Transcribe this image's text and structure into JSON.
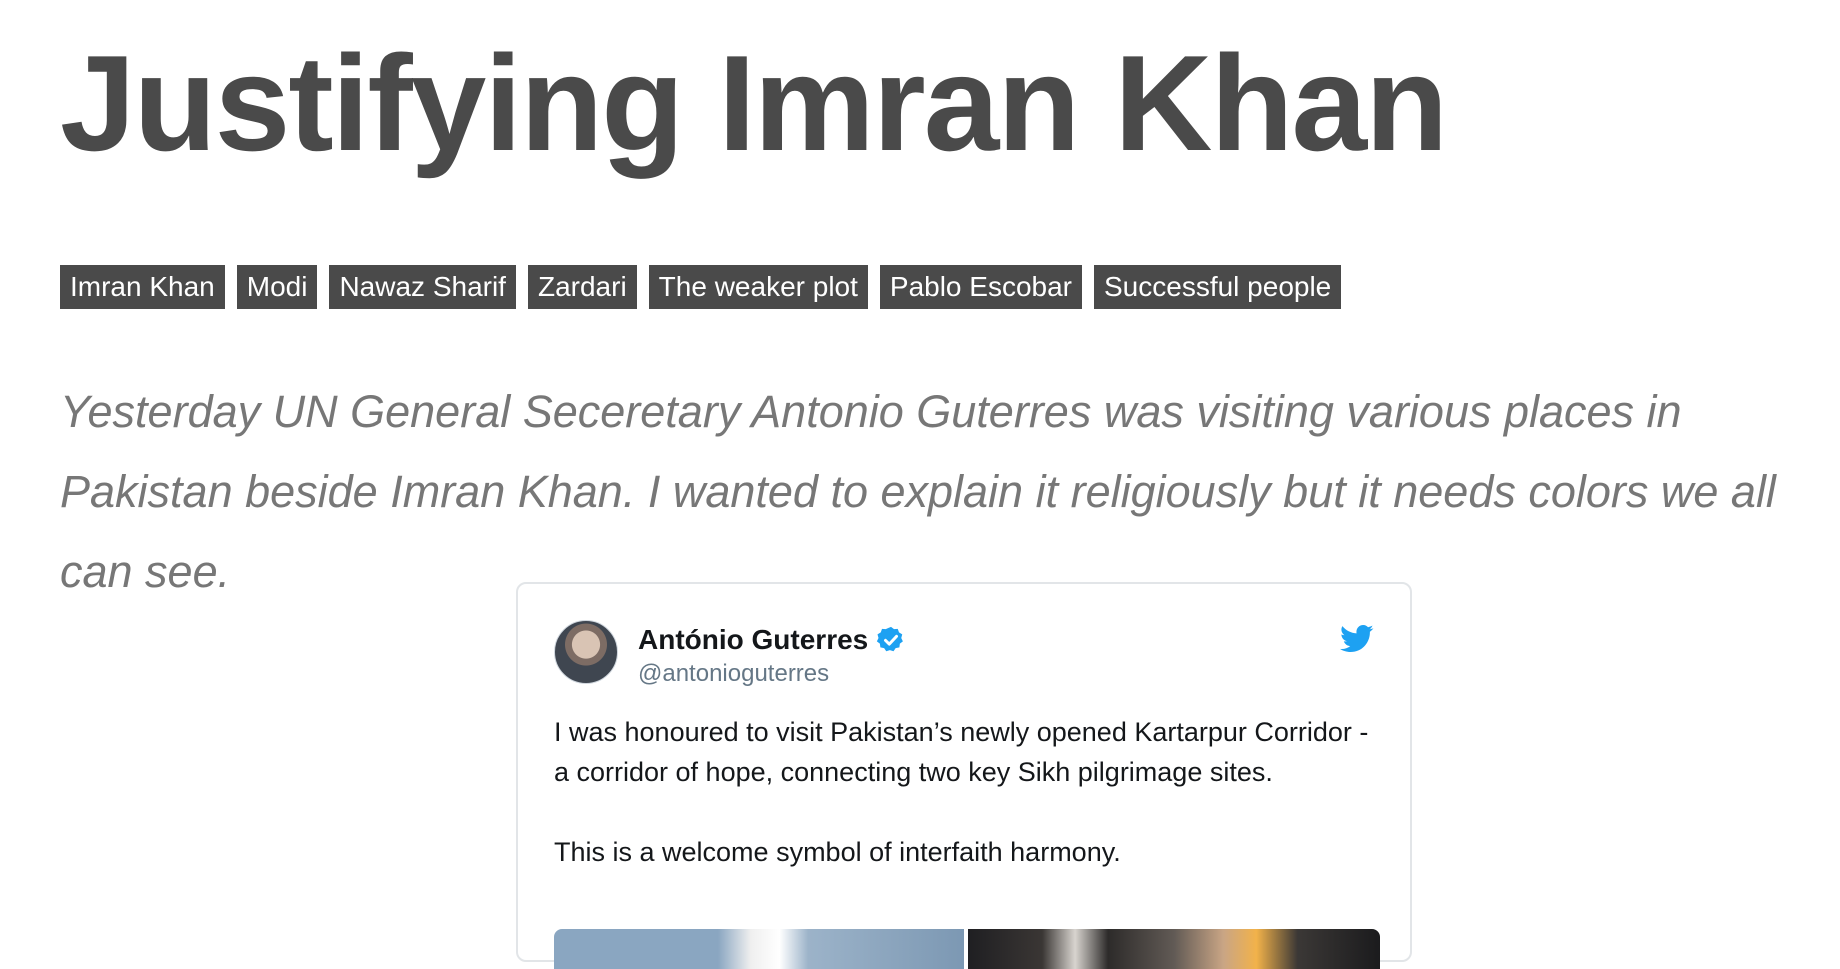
{
  "article": {
    "title": "Justifying Imran Khan",
    "tags": [
      "Imran Khan",
      "Modi",
      "Nawaz Sharif",
      "Zardari",
      "The weaker plot",
      "Pablo Escobar",
      "Successful people"
    ],
    "lead": "Yesterday UN General Seceretary Antonio Guterres was visiting various places in Pakistan beside Imran Khan. I wanted to explain it religiously but it needs colors we all can see."
  },
  "tweet": {
    "user_name": "António Guterres",
    "handle": "@antonioguterres",
    "verified_icon": "verified-badge-icon",
    "platform_icon": "twitter-bird-icon",
    "text": "I was honoured to visit Pakistan’s newly opened Kartarpur Corridor - a corridor of hope, connecting two key Sikh pilgrimage sites.\n\nThis is a welcome symbol of interfaith harmony."
  },
  "colors": {
    "title": "#4a4a4a",
    "tag_bg": "#4a4a4a",
    "tag_text": "#ffffff",
    "lead": "#777777",
    "verified": "#1da1f2",
    "twitter_blue": "#1da1f2",
    "handle": "#657786"
  }
}
